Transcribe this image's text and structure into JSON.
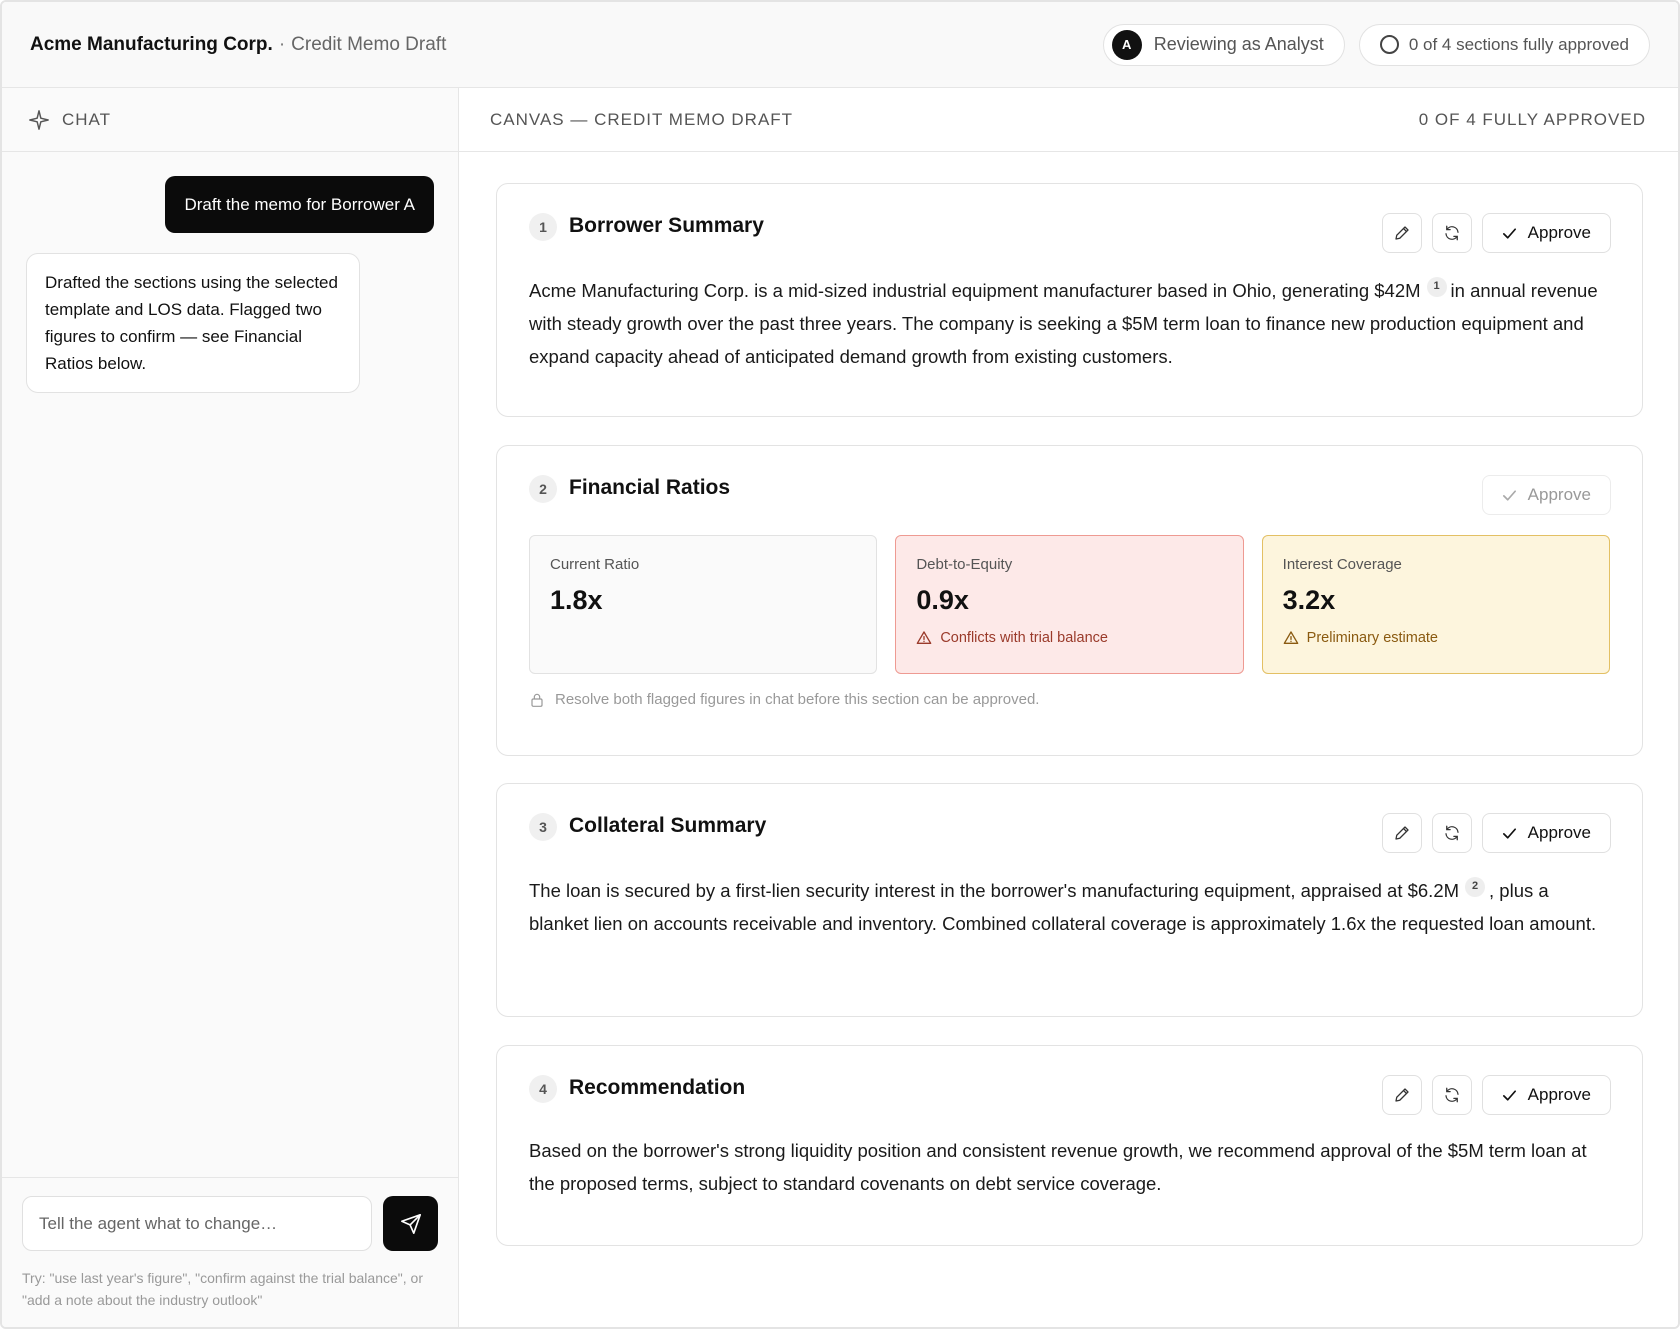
{
  "header": {
    "company": "Acme Manufacturing Corp.",
    "separator": "·",
    "subtitle": "Credit Memo Draft",
    "reviewer_initial": "A",
    "reviewer_label": "Reviewing as Analyst",
    "status_label": "0 of 4 sections fully approved"
  },
  "chat": {
    "title": "CHAT",
    "messages": [
      {
        "role": "user",
        "text": "Draft the memo for Borrower A"
      },
      {
        "role": "agent",
        "text": "Drafted the sections using the selected template and LOS data. Flagged two figures to confirm — see Financial Ratios below."
      }
    ],
    "input_placeholder": "Tell the agent what to change…",
    "hint": "Try: \"use last year's figure\", \"confirm against the trial balance\", or \"add a note about the industry outlook\""
  },
  "canvas": {
    "title": "CANVAS — CREDIT MEMO DRAFT",
    "status": "0 OF 4 FULLY APPROVED",
    "approve_label": "Approve",
    "sections": [
      {
        "number": "1",
        "title": "Borrower Summary",
        "text_a": "Acme Manufacturing Corp. is a mid-sized industrial equipment manufacturer based in Ohio, generating $42M",
        "footnote": "1",
        "text_b": "in annual revenue with steady growth over the past three years. The company is seeking a $5M term loan to finance new production equipment and expand capacity ahead of anticipated demand growth from existing customers."
      },
      {
        "number": "2",
        "title": "Financial Ratios",
        "metrics": [
          {
            "label": "Current Ratio",
            "value": "1.8x",
            "note": ""
          },
          {
            "label": "Debt-to-Equity",
            "value": "0.9x",
            "note": "Conflicts with trial balance"
          },
          {
            "label": "Interest Coverage",
            "value": "3.2x",
            "note": "Preliminary estimate"
          }
        ],
        "lock_note": "Resolve both flagged figures in chat before this section can be approved."
      },
      {
        "number": "3",
        "title": "Collateral Summary",
        "text_a": "The loan is secured by a first-lien security interest in the borrower's manufacturing equipment, appraised at $6.2M",
        "footnote": "2",
        "text_b": ", plus a blanket lien on accounts receivable and inventory. Combined collateral coverage is approximately 1.6x the requested loan amount."
      },
      {
        "number": "4",
        "title": "Recommendation",
        "text": "Based on the borrower's strong liquidity position and consistent revenue growth, we recommend approval of the $5M term loan at the proposed terms, subject to standard covenants on debt service coverage."
      }
    ]
  },
  "colors": {
    "accent": "#0b0b0b",
    "flag_red_bg": "#fde9e8",
    "flag_red_border": "#ee9a92",
    "flag_amber_bg": "#fdf5dd",
    "flag_amber_border": "#e3c064"
  },
  "icons": {
    "chat": "sparkle-icon",
    "send": "paper-plane-icon",
    "edit": "pencil-icon",
    "regenerate": "refresh-icon",
    "approve": "check-icon",
    "warning": "warning-triangle-icon",
    "lock": "lock-icon"
  }
}
